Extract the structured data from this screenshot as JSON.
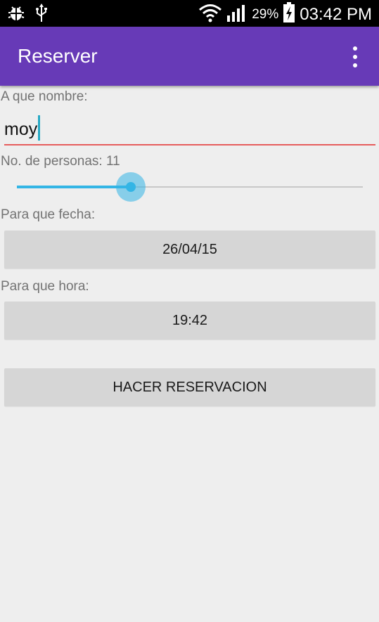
{
  "status_bar": {
    "battery_percent": "29%",
    "time": "03:42 PM",
    "icons": [
      "debug-icon",
      "usb-icon",
      "wifi-icon",
      "signal-icon",
      "battery-charging-icon"
    ]
  },
  "app_bar": {
    "title": "Reserver",
    "menu_icon": "more-vert-icon",
    "color": "#673ab7"
  },
  "form": {
    "name_label": "A que nombre:",
    "name_value": "moy",
    "persons_label": "No. de personas: 11",
    "persons_slider_fraction": 0.33,
    "date_label": "Para que fecha:",
    "date_value": "26/04/15",
    "time_label": "Para que hora:",
    "time_value": "19:42",
    "submit_label": "HACER RESERVACION"
  },
  "colors": {
    "accent": "#33b5e5",
    "input_underline": "#e65c5c",
    "background": "#eeeeee",
    "button": "#d6d6d6"
  }
}
